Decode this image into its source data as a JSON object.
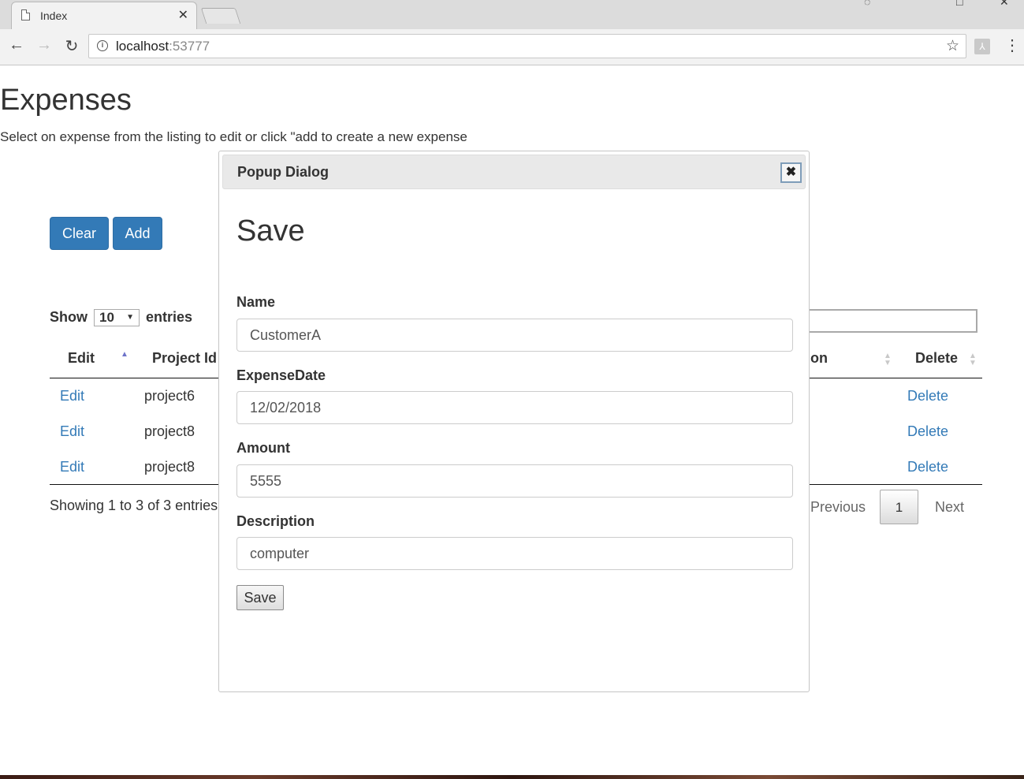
{
  "browser": {
    "tab_title": "Index",
    "tab_close": "✕",
    "url_host": "localhost",
    "url_port": ":53777"
  },
  "page": {
    "title": "Expenses",
    "intro": "Select on expense from the listing to edit or click \"add to create a new expense",
    "clear_label": "Clear",
    "add_label": "Add"
  },
  "table": {
    "show_label": "Show",
    "length_value": "10",
    "entries_label": "entries",
    "columns": {
      "edit": "Edit",
      "project_id": "Project Id",
      "description_partial": "on",
      "delete": "Delete"
    },
    "rows": [
      {
        "edit": "Edit",
        "project_id": "project6",
        "delete": "Delete"
      },
      {
        "edit": "Edit",
        "project_id": "project8",
        "delete": "Delete"
      },
      {
        "edit": "Edit",
        "project_id": "project8",
        "delete": "Delete"
      }
    ],
    "info": "Showing 1 to 3 of 3 entries",
    "pagination": {
      "previous": "Previous",
      "current": "1",
      "next": "Next"
    }
  },
  "dialog": {
    "title": "Popup Dialog",
    "close_symbol": "✖",
    "heading": "Save",
    "fields": {
      "name_label": "Name",
      "name_value": "CustomerA",
      "date_label": "ExpenseDate",
      "date_value": "12/02/2018",
      "amount_label": "Amount",
      "amount_value": "5555",
      "description_label": "Description",
      "description_value": "computer"
    },
    "save_label": "Save"
  },
  "colors": {
    "primary": "#337ab7",
    "link": "#337ab7",
    "sort_active": "#6d73c9"
  }
}
